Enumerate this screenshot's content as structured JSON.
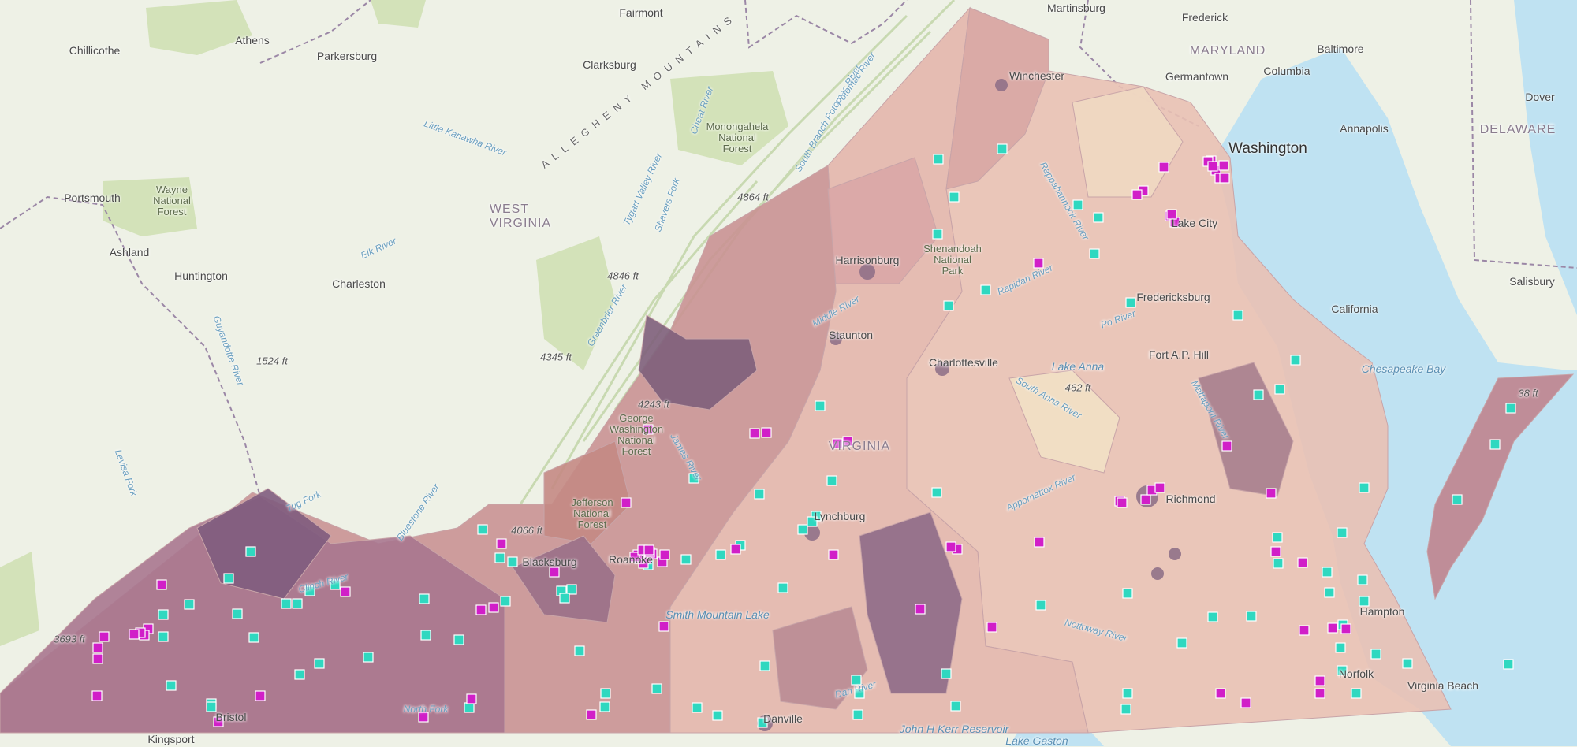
{
  "map": {
    "state_labels": [
      {
        "text": "WEST\nVIRGINIA"
      },
      {
        "text": "VIRGINIA"
      },
      {
        "text": "MARYLAND"
      },
      {
        "text": "DELAWARE"
      }
    ],
    "cities": [
      "Fairmont",
      "Martinsburg",
      "Frederick",
      "Chillicothe",
      "Athens",
      "Parkersburg",
      "Clarksburg",
      "Winchester",
      "Germantown",
      "Columbia",
      "Baltimore",
      "Washington",
      "Annapolis",
      "Dover",
      "Portsmouth",
      "Ashland",
      "Huntington",
      "Charleston",
      "Harrisonburg",
      "Lake City",
      "Fredericksburg",
      "California",
      "Salisbury",
      "Staunton",
      "Charlottesville",
      "Fort A.P. Hill",
      "Richmond",
      "Lynchburg",
      "Blacksburg",
      "Roanoke",
      "Hampton",
      "Virginia Beach",
      "Danville",
      "Kingsport",
      "Bristol",
      "Norfolk"
    ],
    "water_labels": [
      "Chesapeake Bay",
      "Lake Anna",
      "John H Kerr Reservoir",
      "Lake Gaston",
      "Smith Mountain Lake"
    ],
    "rivers": [
      "Little Kanawha River",
      "Elk River",
      "Guyandotte River",
      "Levisa Fork",
      "Tug Fork",
      "Bluestone River",
      "Greenbrier River",
      "Tygart Valley River",
      "Shavers Fork",
      "Cheat River",
      "South Branch Potomac River",
      "Potomac River",
      "Rappahannock River",
      "Rapidan River",
      "Po River",
      "Middle River",
      "South Anna River",
      "Appomattox River",
      "Nottoway River",
      "Dan River",
      "Clinch River",
      "James River",
      "Mattaponi River",
      "North Fork"
    ],
    "parks": [
      "Wayne\nNational\nForest",
      "Monongahela\nNational\nForest",
      "Shenandoah\nNational\nPark",
      "George\nWashington\nNational\nForest",
      "Jefferson\nNational\nForest"
    ],
    "elevations": [
      "4864 ft",
      "4846 ft",
      "4345 ft",
      "1524 ft",
      "4243 ft",
      "4066 ft",
      "3693 ft",
      "462 ft",
      "38 ft"
    ],
    "mountain_label": "ALLEGHENY MOUNTAINS"
  },
  "colors": {
    "marker_teal": "#2fd8c0",
    "marker_magenta": "#d11fc8",
    "choropleth_low": "#f2d9c1",
    "choropleth_high": "#6b4e74",
    "water": "#bfe2f2",
    "land": "#eef1e6"
  }
}
